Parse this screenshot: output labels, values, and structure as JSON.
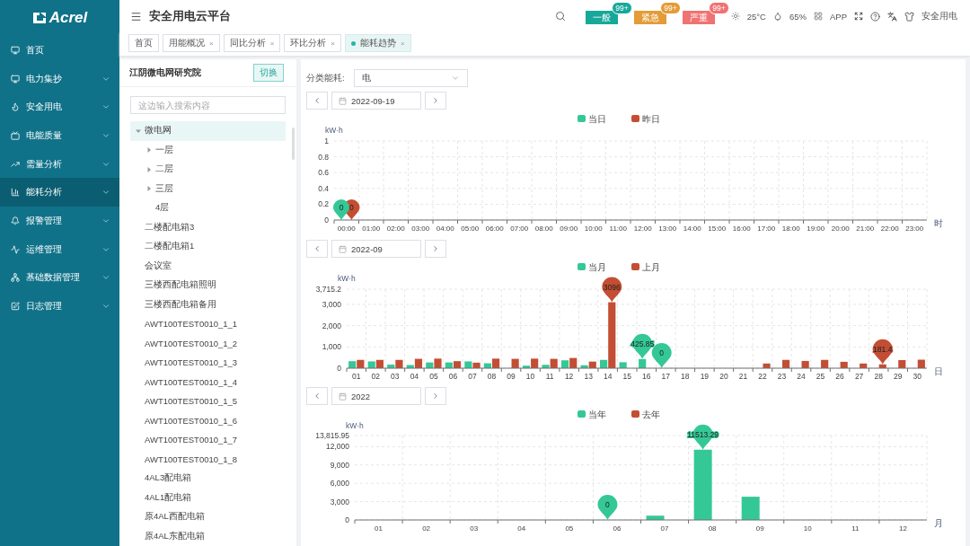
{
  "logo": "Acrel",
  "sidebar": {
    "items": [
      {
        "label": "首页",
        "kind": "link",
        "selected": false
      },
      {
        "label": "电力集抄",
        "kind": "menu",
        "selected": false
      },
      {
        "label": "安全用电",
        "kind": "menu",
        "selected": false
      },
      {
        "label": "电能质量",
        "kind": "menu",
        "selected": false
      },
      {
        "label": "需量分析",
        "kind": "menu",
        "selected": false
      },
      {
        "label": "能耗分析",
        "kind": "menu",
        "selected": true
      },
      {
        "label": "报警管理",
        "kind": "menu",
        "selected": false
      },
      {
        "label": "运维管理",
        "kind": "menu",
        "selected": false
      },
      {
        "label": "基础数据管理",
        "kind": "menu",
        "selected": false
      },
      {
        "label": "日志管理",
        "kind": "menu",
        "selected": false
      }
    ]
  },
  "header": {
    "title": "安全用电云平台",
    "alarms": [
      {
        "label": "一般",
        "count": "99+",
        "color": "#17a89a"
      },
      {
        "label": "紧急",
        "count": "99+",
        "color": "#e39c38"
      },
      {
        "label": "严重",
        "count": "99+",
        "color": "#f07272"
      }
    ],
    "weather": "25°C",
    "humidity": "65%",
    "app": "APP",
    "user": "安全用电"
  },
  "tabs": [
    {
      "label": "首页",
      "selected": false
    },
    {
      "label": "用能概况",
      "close": "×",
      "selected": false
    },
    {
      "label": "同比分析",
      "close": "×",
      "selected": false
    },
    {
      "label": "环比分析",
      "close": "×",
      "selected": false
    },
    {
      "label": "能耗趋势",
      "close": "×",
      "selected": true
    }
  ],
  "tree_panel": {
    "title": "江阴微电网研究院",
    "switch_button": "切换",
    "search": {
      "placeholder": "这边输入搜索内容"
    },
    "nodes": [
      {
        "label": "微电网",
        "kind": "folder",
        "expanded": true,
        "selected": true,
        "children": [
          {
            "label": "一层",
            "kind": "folder",
            "expanded": false,
            "selected": false
          },
          {
            "label": "二层",
            "kind": "folder",
            "expanded": false,
            "selected": false
          },
          {
            "label": "三层",
            "kind": "folder",
            "expanded": false,
            "selected": false
          },
          {
            "label": "4层",
            "kind": "leaf",
            "selected": false
          }
        ]
      },
      {
        "label": "二楼配电箱3",
        "kind": "leaf",
        "selected": false
      },
      {
        "label": "二楼配电箱1",
        "kind": "leaf",
        "selected": false
      },
      {
        "label": "会议室",
        "kind": "leaf",
        "selected": false
      },
      {
        "label": "三楼西配电箱照明",
        "kind": "leaf",
        "selected": false
      },
      {
        "label": "三楼西配电箱备用",
        "kind": "leaf",
        "selected": false
      },
      {
        "label": "AWT100TEST0010_1_1",
        "kind": "leaf",
        "selected": false
      },
      {
        "label": "AWT100TEST0010_1_2",
        "kind": "leaf",
        "selected": false
      },
      {
        "label": "AWT100TEST0010_1_3",
        "kind": "leaf",
        "selected": false
      },
      {
        "label": "AWT100TEST0010_1_4",
        "kind": "leaf",
        "selected": false
      },
      {
        "label": "AWT100TEST0010_1_5",
        "kind": "leaf",
        "selected": false
      },
      {
        "label": "AWT100TEST0010_1_6",
        "kind": "leaf",
        "selected": false
      },
      {
        "label": "AWT100TEST0010_1_7",
        "kind": "leaf",
        "selected": false
      },
      {
        "label": "AWT100TEST0010_1_8",
        "kind": "leaf",
        "selected": false
      },
      {
        "label": "4AL3配电箱",
        "kind": "leaf",
        "selected": false
      },
      {
        "label": "4AL1配电箱",
        "kind": "leaf",
        "selected": false
      },
      {
        "label": "原4AL西配电箱",
        "kind": "leaf",
        "selected": false
      },
      {
        "label": "原4AL东配电箱",
        "kind": "leaf",
        "selected": false
      }
    ]
  },
  "filter": {
    "label": "分类能耗:",
    "value": "电"
  },
  "charts": [
    {
      "date": "2022-09-19",
      "chart_data": {
        "type": "bar",
        "ylabel": "kW·h",
        "xlabel": "时",
        "categories": [
          "00:00",
          "01:00",
          "02:00",
          "03:00",
          "04:00",
          "05:00",
          "06:00",
          "07:00",
          "08:00",
          "09:00",
          "10:00",
          "11:00",
          "12:00",
          "13:00",
          "14:00",
          "15:00",
          "16:00",
          "17:00",
          "18:00",
          "19:00",
          "20:00",
          "21:00",
          "22:00",
          "23:00"
        ],
        "series": [
          {
            "name": "当日",
            "color": "#34c896",
            "values": [
              0,
              null,
              null,
              null,
              null,
              null,
              null,
              null,
              null,
              null,
              null,
              null,
              null,
              null,
              null,
              null,
              null,
              null,
              null,
              null,
              null,
              null,
              null,
              null
            ]
          },
          {
            "name": "昨日",
            "color": "#c34e33",
            "values": [
              0,
              null,
              null,
              null,
              null,
              null,
              null,
              null,
              null,
              null,
              null,
              null,
              null,
              null,
              null,
              null,
              null,
              null,
              null,
              null,
              null,
              null,
              null,
              null
            ]
          }
        ],
        "ylim": [
          0,
          1
        ],
        "yticks": [
          0,
          0.2,
          0.4,
          0.6,
          0.8,
          1
        ],
        "grid": true,
        "legend": "top",
        "annotations": [
          {
            "text": "0",
            "x": "00:00",
            "y": 0
          },
          {
            "text": "0",
            "x": "00:00",
            "y": 0
          }
        ]
      }
    },
    {
      "date": "2022-09",
      "chart_data": {
        "type": "bar",
        "ylabel": "kW·h",
        "xlabel": "日",
        "categories": [
          "01",
          "02",
          "03",
          "04",
          "05",
          "06",
          "07",
          "08",
          "09",
          "10",
          "11",
          "12",
          "13",
          "14",
          "15",
          "16",
          "17",
          "18",
          "19",
          "20",
          "21",
          "22",
          "23",
          "24",
          "25",
          "26",
          "27",
          "28",
          "29",
          "30"
        ],
        "series": [
          {
            "name": "当月",
            "color": "#34c896",
            "values": [
              330,
              320,
              170,
              150,
              270,
              270,
              320,
              230,
              null,
              120,
              160,
              370,
              140,
              390,
              280,
              430,
              0,
              null,
              null,
              null,
              null,
              null,
              null,
              null,
              null,
              null,
              null,
              null,
              null,
              null
            ]
          },
          {
            "name": "上月",
            "color": "#c34e33",
            "values": [
              390,
              390,
              390,
              440,
              450,
              330,
              260,
              450,
              440,
              450,
              440,
              480,
              310,
              3100,
              null,
              null,
              null,
              null,
              null,
              null,
              null,
              220,
              390,
              340,
              390,
              300,
              220,
              180,
              380,
              400
            ]
          }
        ],
        "ylim": [
          0,
          3715.2
        ],
        "yticks": [
          0,
          {
            "value": 1000,
            "label": "1,000"
          },
          {
            "value": 2000,
            "label": "2,000"
          },
          {
            "value": 3000,
            "label": "3,000"
          },
          {
            "value": 3715.2,
            "label": "3,715.2"
          }
        ],
        "grid": true,
        "legend": "top",
        "annotations": [
          {
            "text": "3096",
            "x": "14",
            "y": 3100
          },
          {
            "text": "425.85",
            "x": "16",
            "y": 430
          },
          {
            "text": "0",
            "x": "17",
            "y": 0
          },
          {
            "text": "181.4",
            "x": "28",
            "y": 180
          }
        ]
      }
    },
    {
      "date": "2022",
      "chart_data": {
        "type": "bar",
        "ylabel": "kW·h",
        "xlabel": "月",
        "categories": [
          "01",
          "02",
          "03",
          "04",
          "05",
          "06",
          "07",
          "08",
          "09",
          "10",
          "11",
          "12"
        ],
        "series": [
          {
            "name": "当年",
            "color": "#34c896",
            "values": [
              null,
              null,
              null,
              null,
              null,
              0,
              700,
              11500,
              3800,
              null,
              null,
              null
            ]
          },
          {
            "name": "去年",
            "color": "#c34e33",
            "values": [
              null,
              null,
              null,
              null,
              null,
              null,
              null,
              null,
              null,
              null,
              null,
              null
            ]
          }
        ],
        "ylim": [
          0,
          13815.95
        ],
        "yticks": [
          0,
          {
            "value": 3000,
            "label": "3,000"
          },
          {
            "value": 6000,
            "label": "6,000"
          },
          {
            "value": 9000,
            "label": "9,000"
          },
          {
            "value": 12000,
            "label": "12,000"
          },
          {
            "value": 13815.95,
            "label": "13,815.95"
          }
        ],
        "grid": true,
        "legend": "top",
        "annotations": [
          {
            "text": "0",
            "x": "06",
            "y": 0
          },
          {
            "text": "11513.29",
            "x": "08",
            "y": 11500
          }
        ]
      }
    }
  ]
}
